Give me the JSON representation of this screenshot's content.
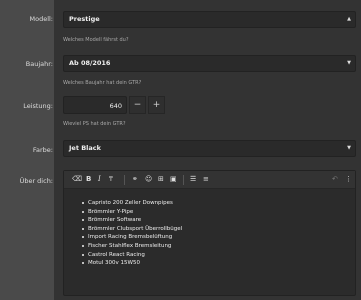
{
  "form": {
    "model": {
      "label": "Modell:",
      "value": "Prestige",
      "help": "Welches Modell fährst du?"
    },
    "year": {
      "label": "Baujahr:",
      "value": "Ab 08/2016",
      "help": "Welches Baujahr hat dein GTR?"
    },
    "power": {
      "label": "Leistung:",
      "value": "640",
      "minus": "−",
      "plus": "+",
      "help": "Wieviel PS hat dein GTR?"
    },
    "color": {
      "label": "Farbe:",
      "value": "Jet Black"
    },
    "about": {
      "label": "Über dich:",
      "items": [
        "Capristo 200 Zeller Downpipes",
        "Brömmler Y-Pipe",
        "Brömmler Software",
        "Brömmler Clubsport Überrollbügel",
        "Import Racing Bremsbelüftung",
        "Fischer Stahlflex Bremsleitung",
        "Castrol React Racing",
        "Motul 300v 15W50"
      ]
    }
  },
  "icons": {
    "eraser": "eraser-icon",
    "bold": "bold-icon",
    "italic": "italic-icon",
    "text_size": "text-size-icon",
    "link": "link-icon",
    "emoji": "emoji-icon",
    "insert": "insert-icon",
    "image": "image-icon",
    "list": "list-icon",
    "ordered_list": "ordered-list-icon",
    "undo": "undo-icon",
    "more": "more-icon"
  }
}
